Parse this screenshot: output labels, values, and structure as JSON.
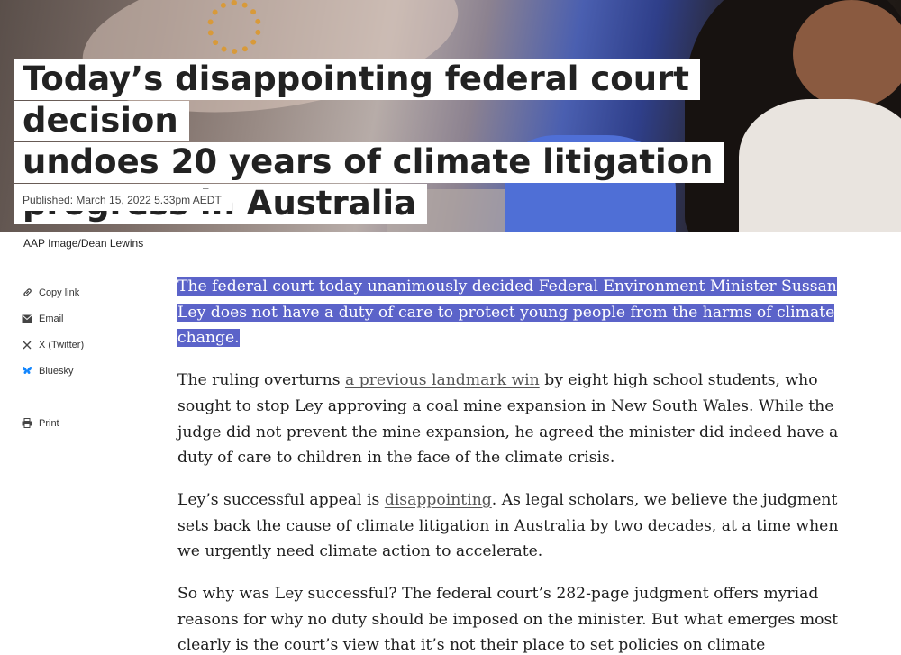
{
  "hero": {
    "headline": "Today’s disappointing federal court decision undoes 20 years of climate litigation progress in Australia",
    "headline_lines": [
      "Today’s disappointing federal court decision",
      "undoes 20 years of climate litigation",
      "progress in Australia"
    ],
    "published": "Published: March 15, 2022 5.33pm AEDT"
  },
  "caption": "AAP Image/Dean Lewins",
  "share": {
    "items": [
      {
        "label": "Copy link",
        "icon": "link-icon"
      },
      {
        "label": "Email",
        "icon": "envelope-icon"
      },
      {
        "label": "X (Twitter)",
        "icon": "x-logo-icon"
      },
      {
        "label": "Bluesky",
        "icon": "butterfly-icon"
      },
      {
        "label": "Print",
        "icon": "printer-icon"
      }
    ]
  },
  "colors": {
    "selection": "#5b63c9",
    "bluesky": "#1185fe"
  },
  "article": {
    "p1_selected": "The federal court today unanimously decided Federal Environment Minister Sussan Ley does not have a duty of care to protect young people from the harms of climate change.",
    "p2_before": "The ruling overturns ",
    "p2_link": "a previous landmark win",
    "p2_after": " by eight high school students, who sought to stop Ley approving a coal mine expansion in New South Wales. While the judge did not prevent the mine expansion, he agreed the minister did indeed have a duty of care to children in the face of the climate crisis.",
    "p3_before": "Ley’s successful appeal is ",
    "p3_link": "disappointing",
    "p3_after": ". As legal scholars, we believe the judgment sets back the cause of climate litigation in Australia by two decades, at a time when we urgently need climate action to accelerate.",
    "p4": "So why was Ley successful? The federal court’s 282-page judgment offers myriad reasons for why no duty should be imposed on the minister. But what emerges most clearly is the court’s view that it’s not their place to set policies on climate"
  }
}
